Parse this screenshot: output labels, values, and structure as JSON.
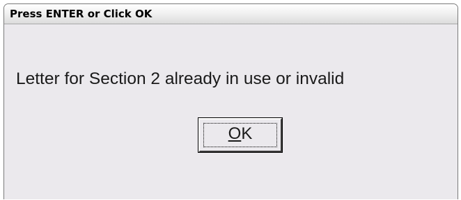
{
  "window": {
    "title": "Press ENTER or Click OK"
  },
  "dialog": {
    "message": "Letter for Section 2 already in use or invalid"
  },
  "buttons": {
    "ok_mnemonic": "O",
    "ok_rest": "K"
  },
  "colors": {
    "dialog_background": "#ebe9ed",
    "text": "#1a1a1a"
  }
}
